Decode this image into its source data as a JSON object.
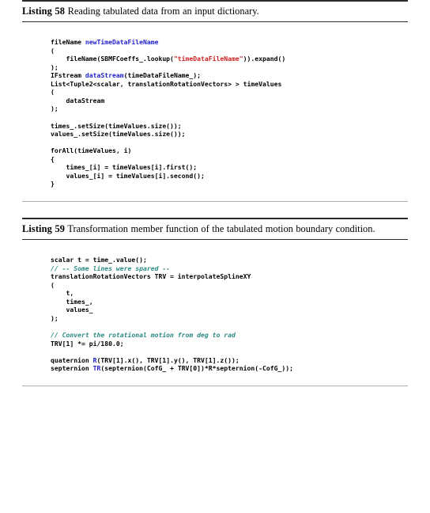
{
  "document": {
    "type": "code-listings-page",
    "colors": {
      "text": "#000000",
      "identifier": "#2222cc",
      "string": "#cc2222",
      "comment": "#2a8a80",
      "rule_dark": "#2b2b2b",
      "rule_light": "#b0b0b0",
      "background": "#ffffff"
    }
  },
  "listings": [
    {
      "label": "Listing 58",
      "caption": "Reading tabulated data from an input dictionary.",
      "lines": [
        {
          "parts": [
            {
              "t": "fileName ",
              "c": "plain"
            },
            {
              "t": "newTimeDataFileName",
              "c": "id"
            }
          ]
        },
        {
          "parts": [
            {
              "t": "(",
              "c": "plain"
            }
          ]
        },
        {
          "parts": [
            {
              "t": "    fileName(SBMFCoeffs_.lookup(",
              "c": "plain"
            },
            {
              "t": "\"timeDataFileName\"",
              "c": "str"
            },
            {
              "t": ")).expand()",
              "c": "plain"
            }
          ]
        },
        {
          "parts": [
            {
              "t": ");",
              "c": "plain"
            }
          ]
        },
        {
          "parts": [
            {
              "t": "IFstream ",
              "c": "plain"
            },
            {
              "t": "dataStream",
              "c": "id"
            },
            {
              "t": "(timeDataFileName_);",
              "c": "plain"
            }
          ]
        },
        {
          "parts": [
            {
              "t": "List<Tuple2<scalar, translationRotationVectors> > timeValues",
              "c": "plain"
            }
          ]
        },
        {
          "parts": [
            {
              "t": "(",
              "c": "plain"
            }
          ]
        },
        {
          "parts": [
            {
              "t": "    dataStream",
              "c": "plain"
            }
          ]
        },
        {
          "parts": [
            {
              "t": ");",
              "c": "plain"
            }
          ]
        },
        {
          "parts": [
            {
              "t": "",
              "c": "plain"
            }
          ]
        },
        {
          "parts": [
            {
              "t": "times_.setSize(timeValues.size());",
              "c": "plain"
            }
          ]
        },
        {
          "parts": [
            {
              "t": "values_.setSize(timeValues.size());",
              "c": "plain"
            }
          ]
        },
        {
          "parts": [
            {
              "t": "",
              "c": "plain"
            }
          ]
        },
        {
          "parts": [
            {
              "t": "forAll(timeValues, i)",
              "c": "plain"
            }
          ]
        },
        {
          "parts": [
            {
              "t": "{",
              "c": "plain"
            }
          ]
        },
        {
          "parts": [
            {
              "t": "    times_[i] = timeValues[i].first();",
              "c": "plain"
            }
          ]
        },
        {
          "parts": [
            {
              "t": "    values_[i] = timeValues[i].second();",
              "c": "plain"
            }
          ]
        },
        {
          "parts": [
            {
              "t": "}",
              "c": "plain"
            }
          ]
        }
      ]
    },
    {
      "label": "Listing 59",
      "caption": "Transformation member function of the tabulated motion boundary condition.",
      "lines": [
        {
          "parts": [
            {
              "t": "scalar t = time_.value();",
              "c": "plain"
            }
          ]
        },
        {
          "parts": [
            {
              "t": "// -- Some lines were spared --",
              "c": "com"
            }
          ]
        },
        {
          "parts": [
            {
              "t": "translationRotationVectors TRV = interpolateSplineXY",
              "c": "plain"
            }
          ]
        },
        {
          "parts": [
            {
              "t": "(",
              "c": "plain"
            }
          ]
        },
        {
          "parts": [
            {
              "t": "    t,",
              "c": "plain"
            }
          ]
        },
        {
          "parts": [
            {
              "t": "    times_,",
              "c": "plain"
            }
          ]
        },
        {
          "parts": [
            {
              "t": "    values_",
              "c": "plain"
            }
          ]
        },
        {
          "parts": [
            {
              "t": ");",
              "c": "plain"
            }
          ]
        },
        {
          "parts": [
            {
              "t": "",
              "c": "plain"
            }
          ]
        },
        {
          "parts": [
            {
              "t": "// Convert the rotational motion from deg to rad",
              "c": "com"
            }
          ]
        },
        {
          "parts": [
            {
              "t": "TRV[1] *= pi/180.0;",
              "c": "plain"
            }
          ]
        },
        {
          "parts": [
            {
              "t": "",
              "c": "plain"
            }
          ]
        },
        {
          "parts": [
            {
              "t": "quaternion ",
              "c": "plain"
            },
            {
              "t": "R",
              "c": "id"
            },
            {
              "t": "(TRV[1].x(), TRV[1].y(), TRV[1].z());",
              "c": "plain"
            }
          ]
        },
        {
          "parts": [
            {
              "t": "septernion ",
              "c": "plain"
            },
            {
              "t": "TR",
              "c": "id"
            },
            {
              "t": "(septernion(CofG_ + TRV[0])*R*septernion(-CofG_));",
              "c": "plain"
            }
          ]
        }
      ]
    }
  ]
}
